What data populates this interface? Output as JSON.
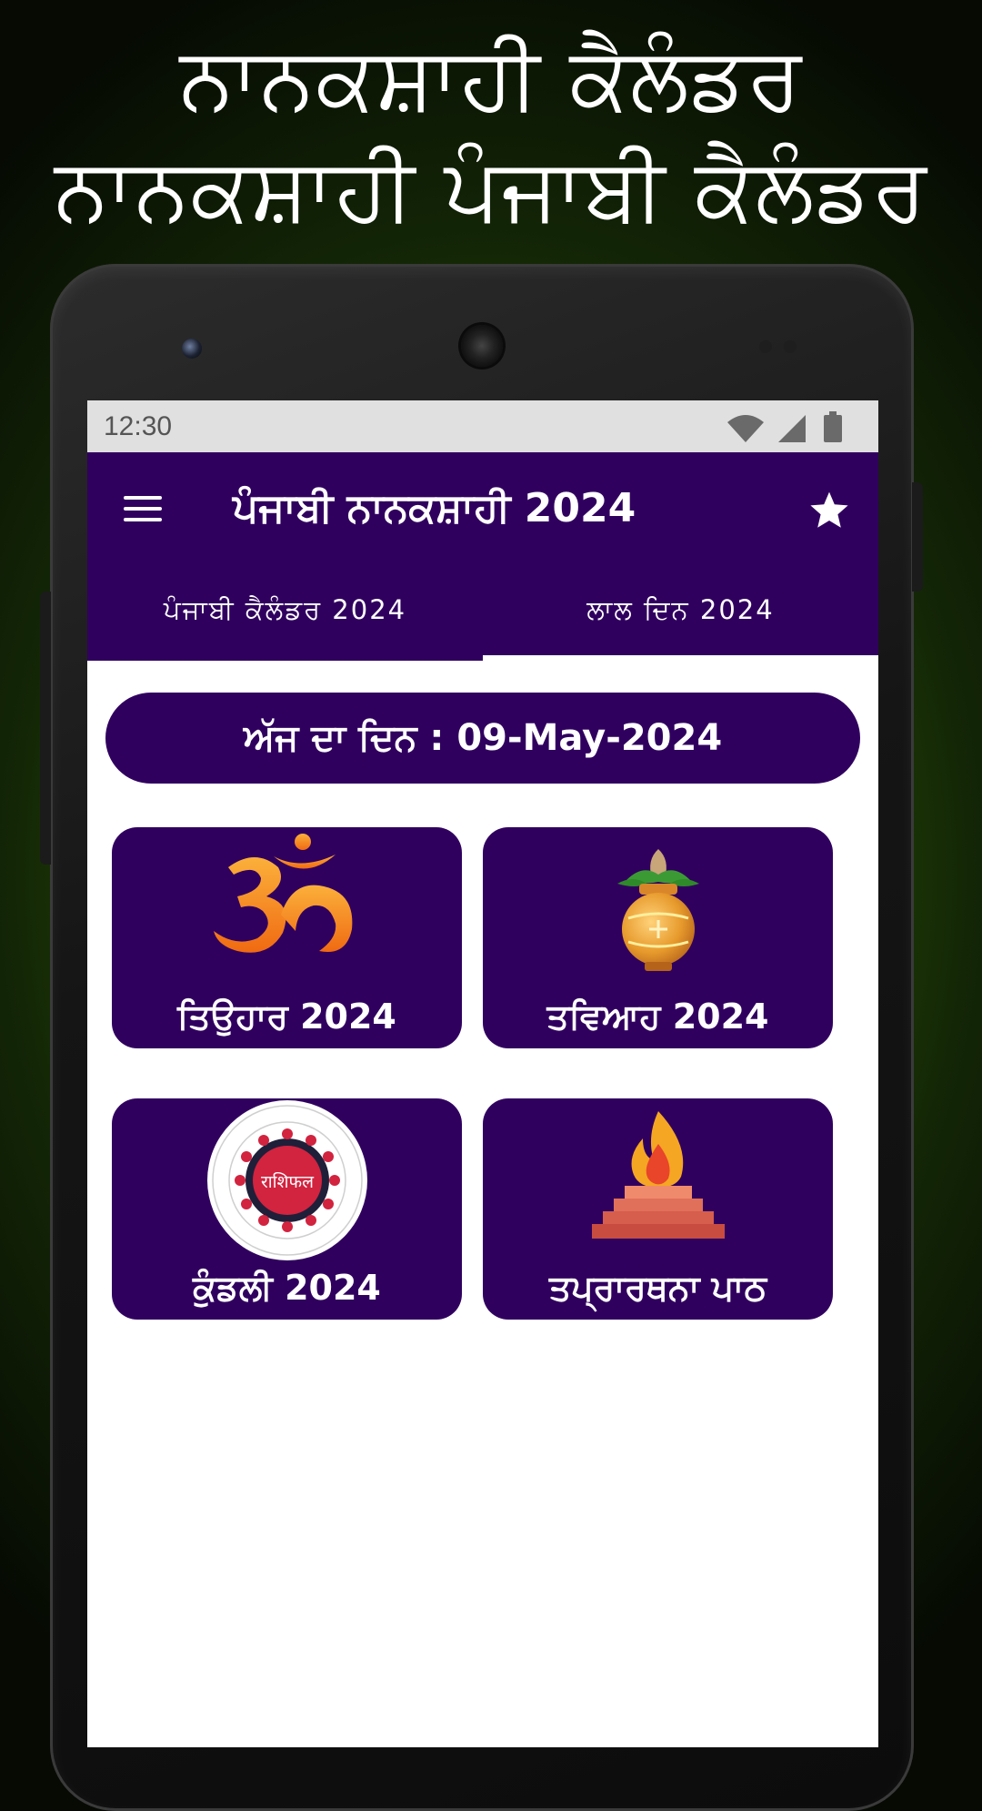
{
  "promo": {
    "line1": "ਨਾਨਕਸ਼ਾਹੀ ਕੈਲੰਡਰ",
    "line2": "ਨਾਨਕਸ਼ਾਹੀ ਪੰਜਾਬੀ ਕੈਲੰਡਰ"
  },
  "status_bar": {
    "time": "12:30",
    "icons": [
      "wifi-icon",
      "signal-icon",
      "battery-icon"
    ]
  },
  "app_bar": {
    "title": "ਪੰਜਾਬੀ ਨਾਨਕਸ਼ਾਹੀ 2024",
    "menu_icon": "hamburger-menu-icon",
    "action_icon": "star-icon"
  },
  "tabs": [
    {
      "label": "ਪੰਜਾਬੀ ਕੈਲੰਡਰ 2024",
      "selected": false
    },
    {
      "label": "ਲਾਲ ਦਿਨ 2024",
      "selected": true
    }
  ],
  "today": {
    "label": "ਅੱਜ ਦਾ ਦਿਨ : 09-May-2024"
  },
  "cards": [
    {
      "label": "ਤਿਉਹਾਰ 2024",
      "icon": "om-icon"
    },
    {
      "label": "ਤਵਿਆਹ 2024",
      "icon": "kalash-icon"
    },
    {
      "label": "ਕੁੰਡਲੀ 2024",
      "icon": "zodiac-wheel-icon",
      "icon_text": "राशिफल"
    },
    {
      "label": "ਤਪ੍ਰਾਰਥਨਾ ਪਾਠ",
      "icon": "havan-fire-icon"
    }
  ],
  "colors": {
    "primary": "#30005f",
    "background_accent": "#3f7a0c",
    "om_orange": "#f07a1a",
    "zodiac_red": "#d2233f",
    "flame": "#f5a623"
  }
}
